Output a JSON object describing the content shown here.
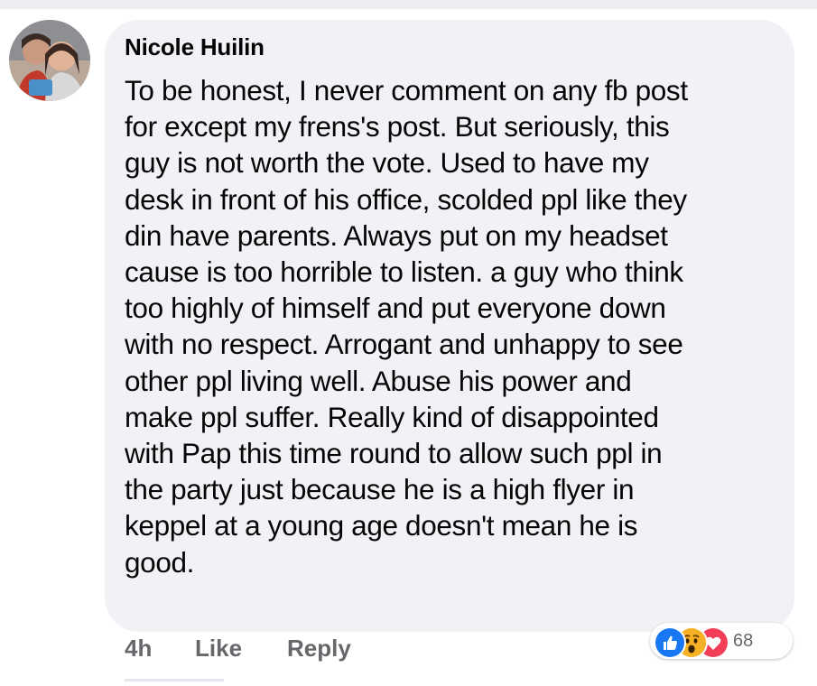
{
  "comment": {
    "author": "Nicole Huilin",
    "body_lines": [
      "To be honest, I never comment on any fb post",
      "for except my frens's post. But seriously, this",
      "guy is not worth the vote. Used to have my",
      "desk in front of his office, scolded ppl like they",
      "din have parents. Always put on my headset",
      "cause is too horrible to listen. a guy who think",
      "too highly of himself and put everyone down",
      "with no respect. Arrogant and unhappy to see",
      "other ppl living well. Abuse his power and",
      "make ppl suffer. Really kind of disappointed",
      "with Pap this time round to allow such ppl in",
      "the party just because he is a high flyer in",
      "keppel at a young age doesn't mean he is",
      "good."
    ]
  },
  "actions": {
    "time": "4h",
    "like_label": "Like",
    "reply_label": "Reply"
  },
  "reactions": {
    "icons": [
      "like-icon",
      "wow-icon",
      "love-icon"
    ],
    "count": "68"
  },
  "colors": {
    "bubble": "#f0f2f5",
    "text": "#050505",
    "meta": "#65676b",
    "like_blue": "#1877f2",
    "love_red": "#f33e58",
    "wow_yellow": "#f7b125"
  }
}
